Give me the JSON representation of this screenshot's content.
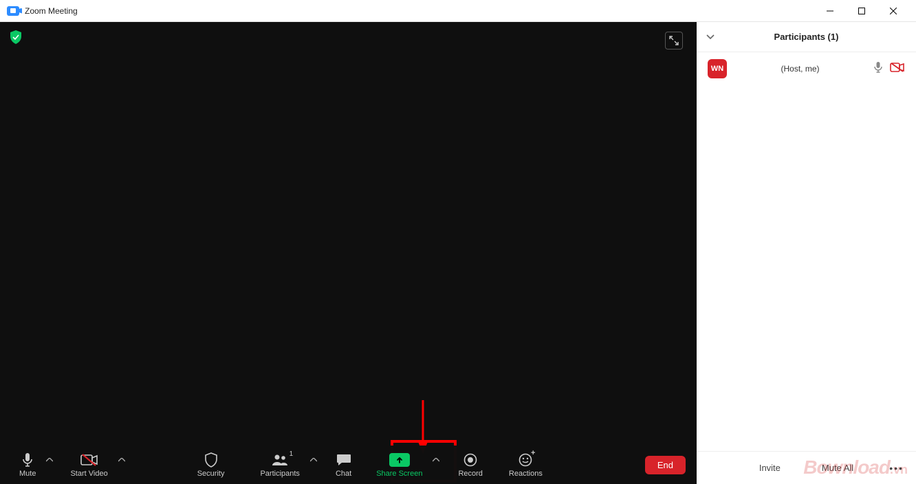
{
  "titlebar": {
    "title": "Zoom Meeting"
  },
  "toolbar": {
    "mute": "Mute",
    "start_video": "Start Video",
    "security": "Security",
    "participants": "Participants",
    "participants_count": "1",
    "chat": "Chat",
    "share_screen": "Share Screen",
    "record": "Record",
    "reactions": "Reactions",
    "end": "End"
  },
  "panel": {
    "title": "Participants (1)",
    "participant": {
      "initials": "WN",
      "role": "(Host, me)"
    },
    "footer": {
      "invite": "Invite",
      "mute_all": "Mute All"
    }
  },
  "watermark": {
    "text": "Bownload",
    "suffix": ".vn"
  }
}
